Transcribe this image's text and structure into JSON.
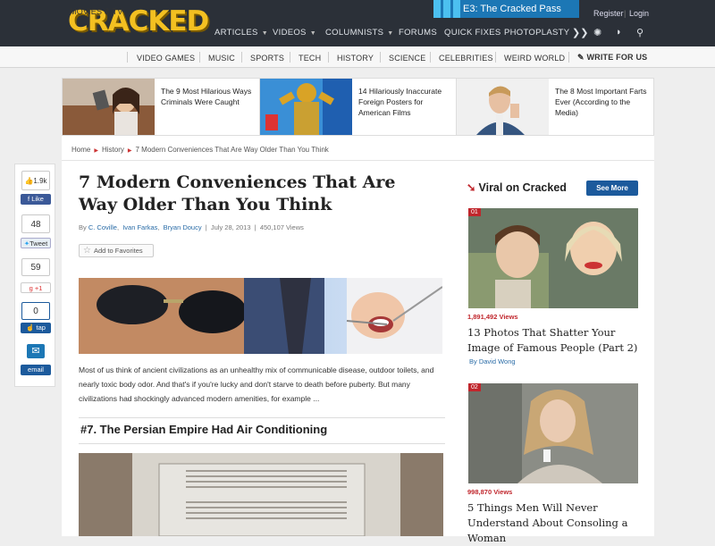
{
  "header": {
    "logo": "CRACKED",
    "promo_bar": "E3: The Cracked Pass",
    "register": "Register",
    "separator": "|",
    "login": "Login",
    "nav": [
      {
        "label": "ARTICLES",
        "dropdown": true
      },
      {
        "label": "VIDEOS",
        "dropdown": true
      },
      {
        "label": "COLUMNISTS",
        "dropdown": true
      },
      {
        "label": "FORUMS"
      },
      {
        "label": "QUICK FIXES"
      },
      {
        "label": "PHOTOPLASTY"
      }
    ],
    "nav_icons": [
      "double-chevron-icon",
      "settings-icon",
      "rss-icon",
      "search-icon"
    ],
    "colors": {
      "background": "#2b3038",
      "logo": "#f3c021",
      "promo": "#1c77b5"
    }
  },
  "subnav": [
    "MOVIES & TV",
    "VIDEO GAMES",
    "MUSIC",
    "SPORTS",
    "TECH",
    "HISTORY",
    "SCIENCE",
    "CELEBRITIES",
    "WEIRD WORLD",
    "WRITE FOR US"
  ],
  "promos": [
    "The 9 Most Hilarious Ways Criminals Were Caught",
    "14 Hilariously Inaccurate Foreign Posters for American Films",
    "The 8 Most Important Farts Ever (According to the Media)"
  ],
  "breadcrumb": [
    "Home",
    "History",
    "7 Modern Conveniences That Are Way Older Than You Think"
  ],
  "article": {
    "title": "7 Modern Conveniences That Are Way Older Than You Think",
    "authors": [
      "C. Coville",
      "Ivan Farkas",
      "Bryan Doucy"
    ],
    "date": "July 28, 2013",
    "views": "450,107 Views",
    "favorite_label": "Add to Favorites",
    "intro": "Most of us think of ancient civilizations as an unhealthy mix of communicable disease, outdoor toilets, and nearly toxic body odor. And that's if you're lucky and don't starve to death before puberty. But many civilizations had shockingly advanced modern amenities, for example ...",
    "section1": "#7. The Persian Empire Had Air Conditioning"
  },
  "share": {
    "fb_count": "1.9k",
    "fb_label": "Like",
    "tw_count": "48",
    "tw_label": "Tweet",
    "gp_count": "59",
    "gp_label": "+1",
    "tap_count": "0",
    "tap_label": "tap",
    "email_label": "email"
  },
  "sidebar": {
    "heading": "Viral on Cracked",
    "see_more": "See More",
    "items": [
      {
        "rank": "01",
        "views": "1,891,492 Views",
        "title": "13 Photos That Shatter Your Image of Famous People (Part 2)",
        "author": "By David Wong"
      },
      {
        "rank": "02",
        "views": "998,870 Views",
        "title": "5 Things Men Will Never Understand About Consoling a Woman",
        "author": ""
      }
    ],
    "accent": "#c0262c"
  }
}
